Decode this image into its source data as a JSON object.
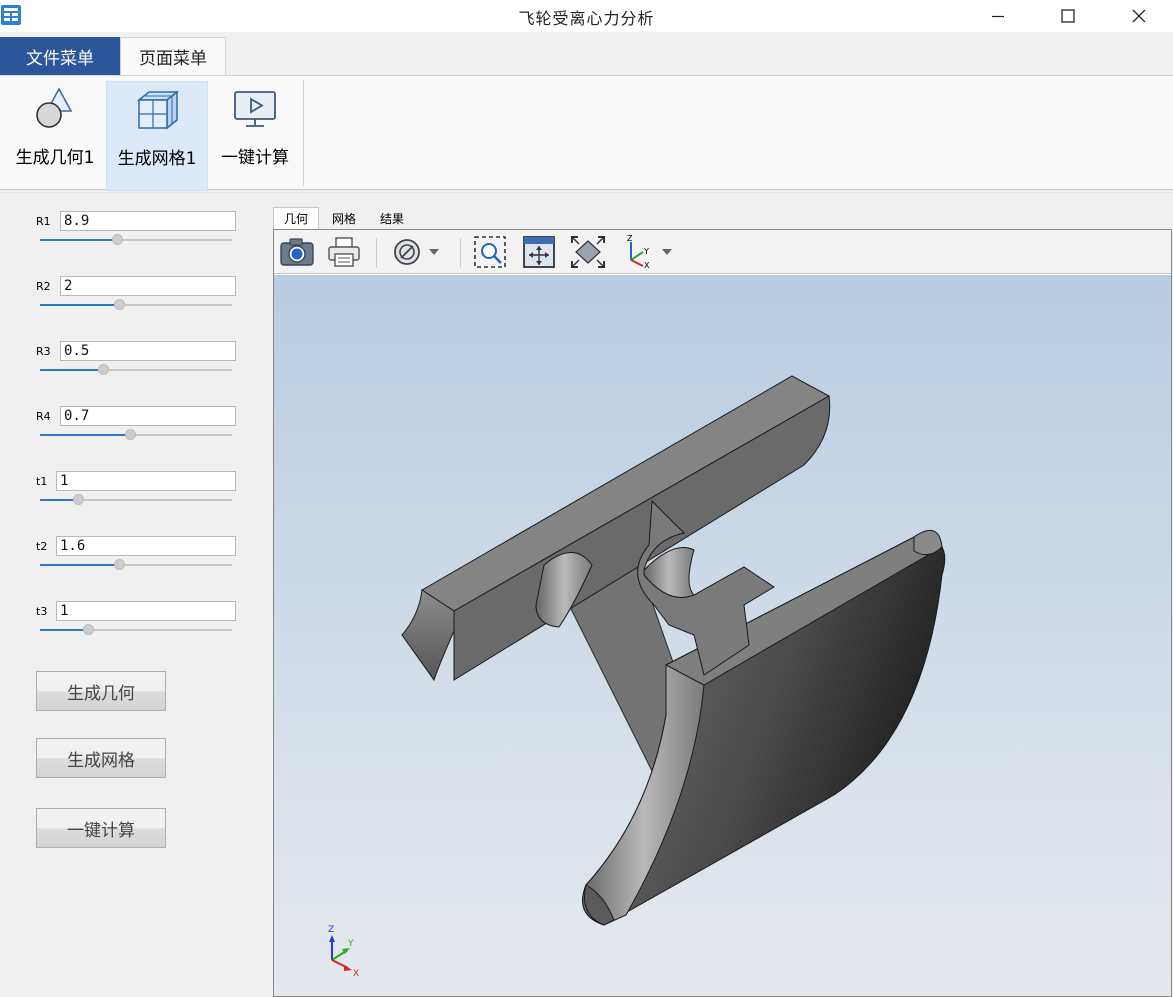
{
  "window": {
    "title": "飞轮受离心力分析",
    "icons": {
      "app": "app-grid-icon",
      "minimize": "minimize-icon",
      "maximize": "maximize-icon",
      "close": "close-icon"
    }
  },
  "menu_tabs": [
    {
      "label": "文件菜单",
      "active": false
    },
    {
      "label": "页面菜单",
      "active": true
    }
  ],
  "ribbon": {
    "buttons": [
      {
        "label": "生成几何1",
        "icon": "geometry-shapes-icon",
        "selected": false
      },
      {
        "label": "生成网格1",
        "icon": "mesh-cube-icon",
        "selected": true
      },
      {
        "label": "一键计算",
        "icon": "monitor-play-icon",
        "selected": false
      }
    ]
  },
  "params": [
    {
      "label": "R1",
      "value": "8.9",
      "slider_fraction": 0.4
    },
    {
      "label": "R2",
      "value": "2",
      "slider_fraction": 0.41
    },
    {
      "label": "R3",
      "value": "0.5",
      "slider_fraction": 0.33
    },
    {
      "label": "R4",
      "value": "0.7",
      "slider_fraction": 0.47
    },
    {
      "label": "t1",
      "value": "1",
      "slider_fraction": 0.2
    },
    {
      "label": "t2",
      "value": "1.6",
      "slider_fraction": 0.41
    },
    {
      "label": "t3",
      "value": "1",
      "slider_fraction": 0.25
    }
  ],
  "actions": [
    {
      "label": "生成几何"
    },
    {
      "label": "生成网格"
    },
    {
      "label": "一键计算"
    }
  ],
  "viewer": {
    "tabs": [
      {
        "label": "几何",
        "active": true
      },
      {
        "label": "网格",
        "active": false
      },
      {
        "label": "结果",
        "active": false
      }
    ],
    "toolbar": [
      {
        "icon": "camera-icon"
      },
      {
        "icon": "printer-icon"
      },
      {
        "icon": "display-mode-icon"
      },
      {
        "icon": "zoom-window-icon"
      },
      {
        "icon": "fit-all-icon"
      },
      {
        "icon": "fit-view-icon"
      },
      {
        "icon": "axis-view-icon"
      }
    ],
    "triad": {
      "z": "Z",
      "y": "Y",
      "x": "X"
    },
    "colors": {
      "bg_top": "#b7cce3",
      "bg_bottom": "#e6e8ee",
      "model": "#808080"
    }
  }
}
